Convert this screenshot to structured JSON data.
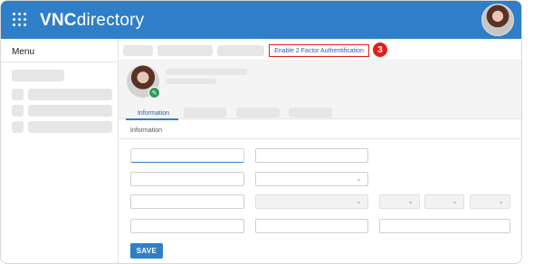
{
  "app": {
    "brand_bold": "VNC",
    "brand_rest": "directory"
  },
  "sidebar": {
    "title": "Menu"
  },
  "toolbar": {
    "twofa_link": "Enable 2 Factor Authentification",
    "step_badge": "3"
  },
  "profile": {
    "active_tab": "Information"
  },
  "form": {
    "section_title": "Information",
    "save_label": "SAVE"
  },
  "colors": {
    "topbar": "#2f7fc8",
    "accent": "#2f7fc8",
    "highlight": "#e0211b",
    "edit_badge": "#2e9e5b"
  },
  "icons": {
    "apps": "apps-grid-icon",
    "edit": "pencil-icon",
    "dropdown": "chevron-down-icon"
  }
}
